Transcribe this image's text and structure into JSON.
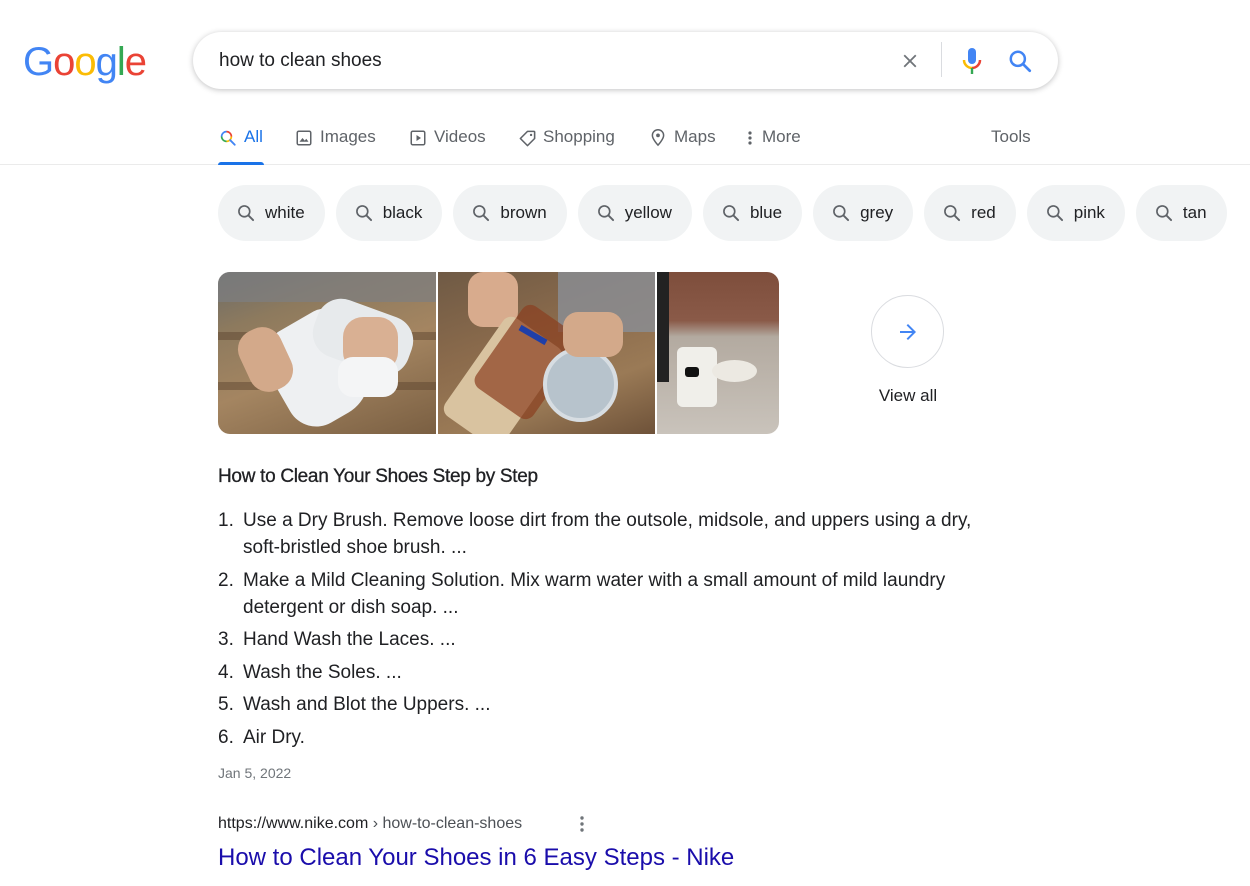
{
  "logo": {
    "letters": [
      "G",
      "o",
      "o",
      "g",
      "l",
      "e"
    ],
    "colors": [
      "#4285f4",
      "#ea4335",
      "#fbbc05",
      "#4285f4",
      "#34a853",
      "#ea4335"
    ]
  },
  "search": {
    "query": "how to clean shoes",
    "placeholder": ""
  },
  "tabs": [
    {
      "label": "All",
      "icon": "search-icon",
      "active": true
    },
    {
      "label": "Images",
      "icon": "image-icon"
    },
    {
      "label": "Videos",
      "icon": "play-icon"
    },
    {
      "label": "Shopping",
      "icon": "tag-icon"
    },
    {
      "label": "Maps",
      "icon": "map-pin-icon"
    },
    {
      "label": "More",
      "icon": "more-vert-icon"
    }
  ],
  "tools_label": "Tools",
  "chips": [
    "white",
    "black",
    "brown",
    "yellow",
    "blue",
    "grey",
    "red",
    "pink",
    "tan"
  ],
  "images": {
    "thumbnails": [
      "person wiping white sneakers on wooden table",
      "person scrubbing shoe sole with toothbrush over water",
      "white high-top sneaker on sidewalk"
    ],
    "view_all_label": "View all"
  },
  "snippet": {
    "title": "How to Clean Your Shoes Step by Step",
    "steps": [
      {
        "num": "1.",
        "text": "Use a Dry Brush. Remove loose dirt from the outsole, midsole, and uppers using a dry, soft-bristled shoe brush. ..."
      },
      {
        "num": "2.",
        "text": "Make a Mild Cleaning Solution. Mix warm water with a small amount of mild laundry detergent or dish soap. ..."
      },
      {
        "num": "3.",
        "text": "Hand Wash the Laces. ..."
      },
      {
        "num": "4.",
        "text": "Wash the Soles. ..."
      },
      {
        "num": "5.",
        "text": "Wash and Blot the Uppers. ..."
      },
      {
        "num": "6.",
        "text": "Air Dry."
      }
    ],
    "date": "Jan 5, 2022"
  },
  "result": {
    "domain": "https://www.nike.com",
    "separator": " › ",
    "path": "how-to-clean-shoes",
    "title": "How to Clean Your Shoes in 6 Easy Steps - Nike"
  },
  "colors": {
    "accent": "#1a73e8",
    "link": "#1a0dab",
    "chip_bg": "#f1f3f4",
    "muted": "#5f6368"
  }
}
